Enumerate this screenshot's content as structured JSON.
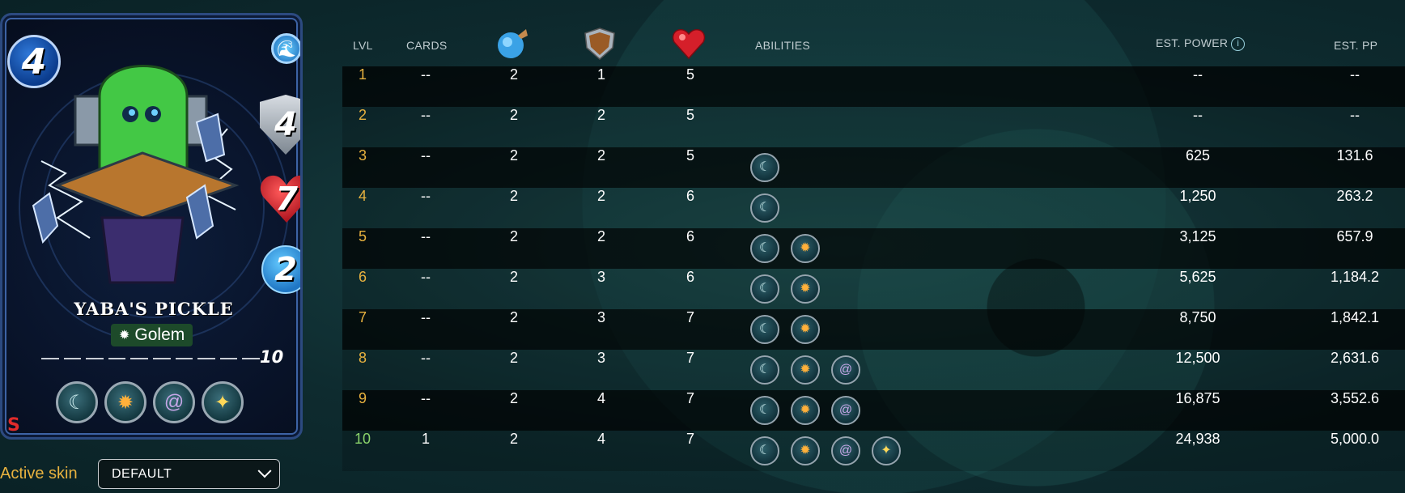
{
  "card": {
    "name": "YABA'S PICKLE",
    "type": "Golem",
    "mana": "4",
    "armor": "4",
    "health": "7",
    "magic": "2",
    "level": "10",
    "abilities": [
      "retaliate-icon",
      "blast-icon",
      "spiral-icon",
      "shine-icon"
    ]
  },
  "skin": {
    "label": "Active skin",
    "selected": "DEFAULT"
  },
  "table": {
    "headers": {
      "lvl": "LVL",
      "cards": "CARDS",
      "magic": "magic-attack-icon",
      "armor": "armor-shield-icon",
      "health": "health-heart-icon",
      "abilities": "ABILITIES",
      "est_power": "EST. POWER",
      "est_pp": "EST. PP"
    },
    "rows": [
      {
        "lvl": "1",
        "cards": "--",
        "magic": "2",
        "armor": "1",
        "health": "5",
        "abilities": [],
        "power": "--",
        "pp": "--"
      },
      {
        "lvl": "2",
        "cards": "--",
        "magic": "2",
        "armor": "2",
        "health": "5",
        "abilities": [],
        "power": "--",
        "pp": "--"
      },
      {
        "lvl": "3",
        "cards": "--",
        "magic": "2",
        "armor": "2",
        "health": "5",
        "abilities": [
          "retaliate"
        ],
        "power": "625",
        "pp": "131.6"
      },
      {
        "lvl": "4",
        "cards": "--",
        "magic": "2",
        "armor": "2",
        "health": "6",
        "abilities": [
          "retaliate"
        ],
        "power": "1,250",
        "pp": "263.2"
      },
      {
        "lvl": "5",
        "cards": "--",
        "magic": "2",
        "armor": "2",
        "health": "6",
        "abilities": [
          "retaliate",
          "blast"
        ],
        "power": "3,125",
        "pp": "657.9"
      },
      {
        "lvl": "6",
        "cards": "--",
        "magic": "2",
        "armor": "3",
        "health": "6",
        "abilities": [
          "retaliate",
          "blast"
        ],
        "power": "5,625",
        "pp": "1,184.2"
      },
      {
        "lvl": "7",
        "cards": "--",
        "magic": "2",
        "armor": "3",
        "health": "7",
        "abilities": [
          "retaliate",
          "blast"
        ],
        "power": "8,750",
        "pp": "1,842.1"
      },
      {
        "lvl": "8",
        "cards": "--",
        "magic": "2",
        "armor": "3",
        "health": "7",
        "abilities": [
          "retaliate",
          "blast",
          "spiral"
        ],
        "power": "12,500",
        "pp": "2,631.6"
      },
      {
        "lvl": "9",
        "cards": "--",
        "magic": "2",
        "armor": "4",
        "health": "7",
        "abilities": [
          "retaliate",
          "blast",
          "spiral"
        ],
        "power": "16,875",
        "pp": "3,552.6"
      },
      {
        "lvl": "10",
        "cards": "1",
        "magic": "2",
        "armor": "4",
        "health": "7",
        "abilities": [
          "retaliate",
          "blast",
          "spiral",
          "shine"
        ],
        "power": "24,938",
        "pp": "5,000.0"
      }
    ]
  },
  "colors": {
    "level_text": "#e8b23f",
    "max_level_text": "#8bd46b",
    "accent_info": "#9ad2de"
  }
}
